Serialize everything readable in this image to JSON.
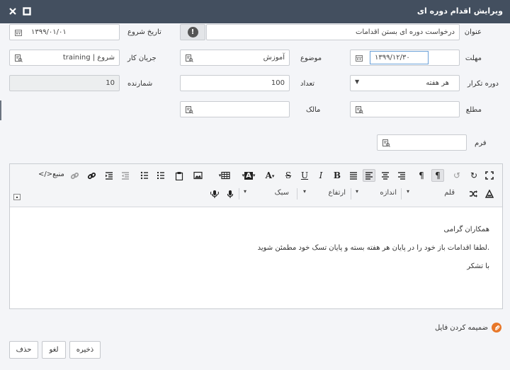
{
  "window": {
    "title": "ویرایش اقدام دوره ای"
  },
  "fields": {
    "title": {
      "label": "عنوان",
      "value": "درخواست دوره ای بستن اقدامات"
    },
    "start_date": {
      "label": "تاریخ شروع",
      "value": "۱۳۹۹/۰۱/۰۱"
    },
    "deadline": {
      "label": "مهلت",
      "value": "۱۳۹۹/۱۲/۳۰"
    },
    "subject": {
      "label": "موضوع",
      "value": "آموزش"
    },
    "workflow": {
      "label": "جریان کار",
      "value": "training | شروع"
    },
    "repeat": {
      "label": "دوره تکرار",
      "value": "هر هفته"
    },
    "count": {
      "label": "تعداد",
      "value": "100"
    },
    "counter": {
      "label": "شمارنده",
      "value": "10"
    },
    "notify": {
      "label": "مطلع",
      "value": ""
    },
    "owner": {
      "label": "مالک",
      "value": ""
    },
    "form": {
      "label": "فرم",
      "value": ""
    }
  },
  "toolbar": {
    "source_label": "منبع",
    "font_select": "قلم",
    "size_select": "اندازه",
    "height_select": "ارتفاع",
    "style_select": "سبک"
  },
  "editor": {
    "lines": [
      "همکاران گرامی",
      "لطفا اقدامات باز خود را در پایان هر هفته بسته و پایان تسک خود مطمئن شوید.",
      "با تشکر"
    ]
  },
  "attach": {
    "label": "ضمیمه کردن فایل"
  },
  "buttons": {
    "save": "ذخیره",
    "cancel": "لغو",
    "delete": "حذف"
  }
}
